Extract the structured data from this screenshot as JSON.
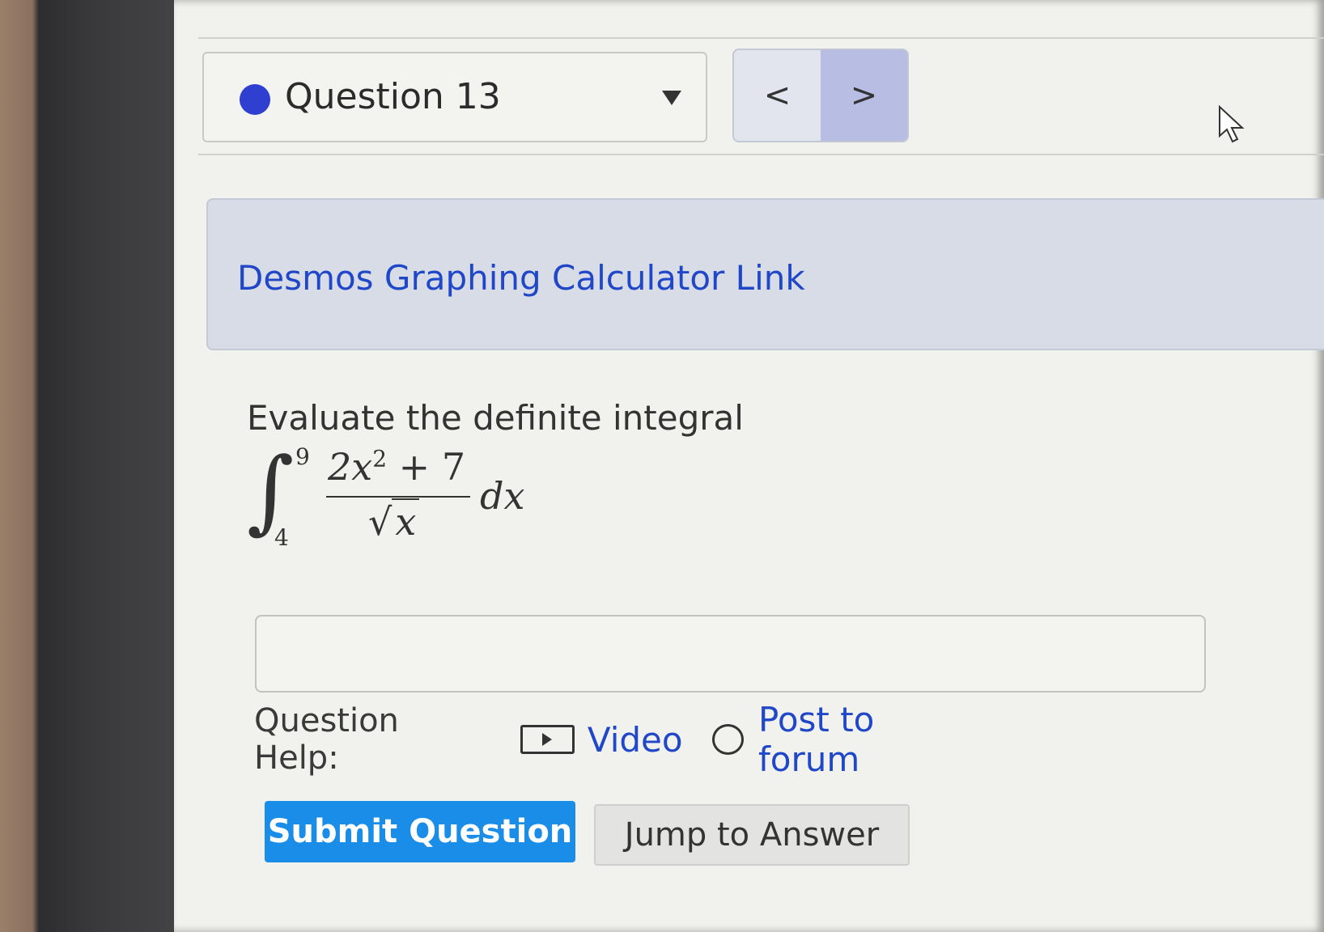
{
  "question_nav": {
    "label": "Question 13",
    "prev_glyph": "<",
    "next_glyph": ">"
  },
  "desmos": {
    "link_text": "Desmos Graphing Calculator Link"
  },
  "problem": {
    "prompt": "Evaluate the definite integral",
    "integral": {
      "lower": "4",
      "upper": "9",
      "numerator_coef": "2x",
      "numerator_exp": "2",
      "numerator_rest": " + 7",
      "denominator": "x",
      "differential": "dx"
    }
  },
  "answer": {
    "value": "",
    "placeholder": ""
  },
  "help": {
    "label": "Question Help:",
    "video": "Video",
    "forum": "Post to forum"
  },
  "actions": {
    "submit": "Submit Question",
    "jump": "Jump to Answer"
  },
  "colors": {
    "link": "#1f47c8",
    "submit_bg": "#1a8de8",
    "status_dot": "#2f3fcf"
  }
}
